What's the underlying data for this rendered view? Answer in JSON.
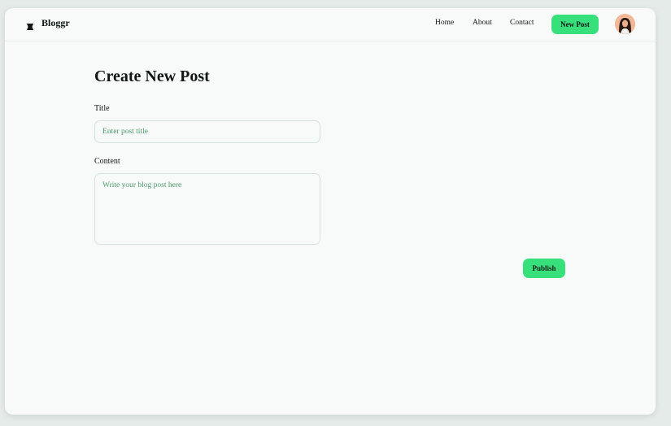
{
  "app": {
    "brand": "Bloggr",
    "logo_icon": "logo-icon"
  },
  "nav": {
    "items": [
      {
        "label": "Home"
      },
      {
        "label": "About"
      },
      {
        "label": "Contact"
      }
    ],
    "new_post_label": "New Post",
    "avatar_icon": "user-avatar"
  },
  "form": {
    "heading": "Create New Post",
    "title_label": "Title",
    "title_value": "",
    "title_placeholder": "Enter post title",
    "content_label": "Content",
    "content_value": "",
    "content_placeholder": "Write your blog post here",
    "publish_label": "Publish"
  },
  "colors": {
    "accent": "#38e07b",
    "placeholder": "#4c9a6b",
    "border": "#d6e3dc",
    "text": "#111714",
    "background": "#f8fafa"
  }
}
